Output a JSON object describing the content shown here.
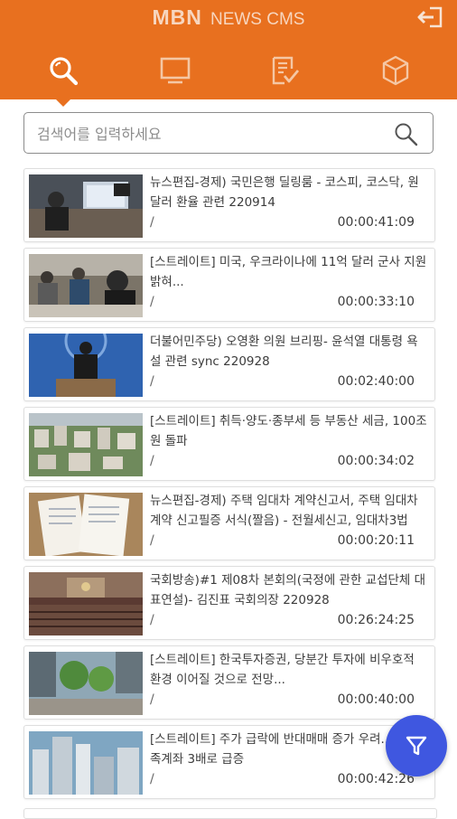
{
  "header": {
    "brand_main": "MBN",
    "brand_sub": "NEWS CMS",
    "tabs": [
      {
        "icon": "search-icon",
        "active": true
      },
      {
        "icon": "monitor-icon",
        "active": false
      },
      {
        "icon": "checklist-icon",
        "active": false
      },
      {
        "icon": "cube-icon",
        "active": false
      }
    ]
  },
  "search": {
    "placeholder": "검색어를 입력하세요",
    "value": ""
  },
  "items": [
    {
      "title": "뉴스편집-경제) 국민은행 딜링룸 - 코스피, 코스닥, 원달러 환율 관련 220914",
      "slash": "/",
      "duration": "00:00:41:09"
    },
    {
      "title": "[스트레이트] 미국, 우크라이나에 11억 달러 군사 지원 밝혀...",
      "slash": "/",
      "duration": "00:00:33:10"
    },
    {
      "title": "더불어민주당) 오영환 의원 브리핑- 윤석열 대통령 욕설 관련 sync 220928",
      "slash": "/",
      "duration": "00:02:40:00"
    },
    {
      "title": "[스트레이트] 취득·양도·종부세 등 부동산 세금, 100조원 돌파",
      "slash": "/",
      "duration": "00:00:34:02"
    },
    {
      "title": "뉴스편집-경제) 주택 임대차 계약신고서, 주택 임대차 계약 신고필증 서식(짤음) - 전월세신고, 임대차3법",
      "slash": "/",
      "duration": "00:00:20:11"
    },
    {
      "title": "국회방송)#1 제08차 본회의(국정에 관한 교섭단체 대표연설)- 김진표 국회의장 220928",
      "slash": "/",
      "duration": "00:26:24:25"
    },
    {
      "title": "[스트레이트] 한국투자증권, 당분간 투자에 비우호적 환경 이어질 것으로 전망...",
      "slash": "/",
      "duration": "00:00:40:00"
    },
    {
      "title": "[스트레이트] 주가 급락에 반대매매 증가 우려... 보부족계좌 3배로 급증",
      "slash": "/",
      "duration": "00:00:42:26"
    }
  ],
  "colors": {
    "header": "#e8701f",
    "fab": "#3f57e0"
  },
  "fab": {
    "icon": "filter-icon"
  }
}
